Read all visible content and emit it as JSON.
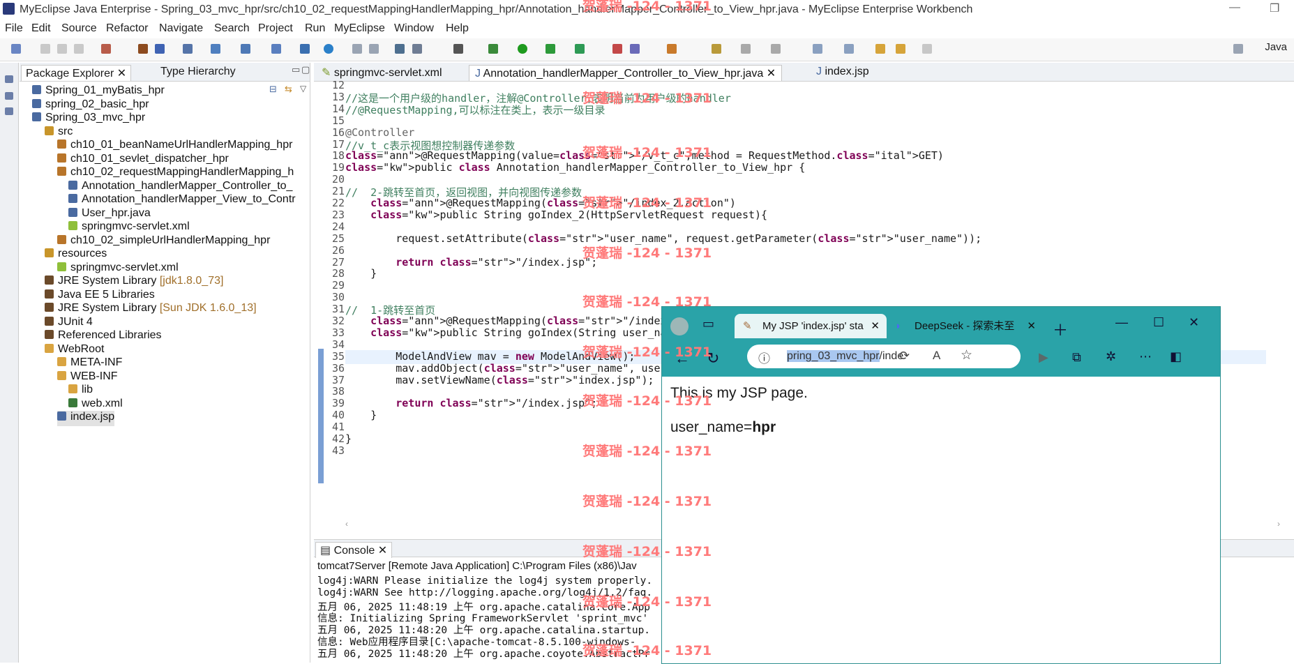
{
  "window": {
    "title": "MyEclipse Java Enterprise - Spring_03_mvc_hpr/src/ch10_02_requestMappingHandlerMapping_hpr/Annotation_handlerMapper_Controller_to_View_hpr.java - MyEclipse Enterprise Workbench",
    "min": "—",
    "restore": "❐"
  },
  "menu": [
    "File",
    "Edit",
    "Source",
    "Refactor",
    "Navigate",
    "Search",
    "Project",
    "Run",
    "MyEclipse",
    "Window",
    "Help"
  ],
  "perspective": "Java",
  "left_pane": {
    "tabs": [
      "Package Explorer",
      "Type Hierarchy"
    ],
    "tree": [
      {
        "label": "Spring_01_myBatis_hpr",
        "deco": ""
      },
      {
        "label": "spring_02_basic_hpr",
        "deco": ""
      },
      {
        "label": "Spring_03_mvc_hpr",
        "deco": ""
      },
      {
        "label": "src",
        "deco": ""
      },
      {
        "label": "ch10_01_beanNameUrlHandlerMapping_hpr",
        "deco": ""
      },
      {
        "label": "ch10_01_sevlet_dispatcher_hpr",
        "deco": ""
      },
      {
        "label": "ch10_02_requestMappingHandlerMapping_h",
        "deco": ""
      },
      {
        "label": "Annotation_handlerMapper_Controller_to_",
        "deco": ""
      },
      {
        "label": "Annotation_handlerMapper_View_to_Contr",
        "deco": ""
      },
      {
        "label": "User_hpr.java",
        "deco": ""
      },
      {
        "label": "springmvc-servlet.xml",
        "deco": ""
      },
      {
        "label": "ch10_02_simpleUrlHandlerMapping_hpr",
        "deco": ""
      },
      {
        "label": "resources",
        "deco": ""
      },
      {
        "label": "springmvc-servlet.xml",
        "deco": ""
      },
      {
        "label": "JRE System Library ",
        "deco": "[jdk1.8.0_73]"
      },
      {
        "label": "Java EE 5 Libraries",
        "deco": ""
      },
      {
        "label": "JRE System Library ",
        "deco": "[Sun JDK 1.6.0_13]"
      },
      {
        "label": "JUnit 4",
        "deco": ""
      },
      {
        "label": "Referenced Libraries",
        "deco": ""
      },
      {
        "label": "WebRoot",
        "deco": ""
      },
      {
        "label": "META-INF",
        "deco": ""
      },
      {
        "label": "WEB-INF",
        "deco": ""
      },
      {
        "label": "lib",
        "deco": ""
      },
      {
        "label": "web.xml",
        "deco": ""
      },
      {
        "label": "index.jsp",
        "deco": ""
      }
    ]
  },
  "editor": {
    "tabs": [
      "springmvc-servlet.xml",
      "Annotation_handlerMapper_Controller_to_View_hpr.java",
      "index.jsp"
    ],
    "lines": [
      {
        "n": "12",
        "html": ""
      },
      {
        "n": "13",
        "text": "//这是一个用户级的handler，注解@Controller,表明当前为用户级的handler",
        "cls": "cmt"
      },
      {
        "n": "14",
        "text": "//@RequestMapping,可以标注在类上，表示一级目录",
        "cls": "cmt"
      },
      {
        "n": "15",
        "text": ""
      },
      {
        "n": "16",
        "text": "@Controller",
        "cls": "ann"
      },
      {
        "n": "17",
        "text": "//v_t_c表示视图想控制器传递参数",
        "cls": "cmt"
      },
      {
        "n": "18",
        "text": "@RequestMapping(value=\"/v_t_c\",method = RequestMethod.GET)",
        "cls": "mix"
      },
      {
        "n": "19",
        "text": "public class Annotation_handlerMapper_Controller_to_View_hpr {",
        "cls": "mix"
      },
      {
        "n": "20",
        "text": ""
      },
      {
        "n": "21",
        "text": "//  2-跳转至首页，返回视图，并向视图传递参数",
        "cls": "cmt"
      },
      {
        "n": "22",
        "text": "    @RequestMapping(\"/index_2.action\")",
        "cls": "mix"
      },
      {
        "n": "23",
        "text": "    public String goIndex_2(HttpServletRequest request){",
        "cls": "mix"
      },
      {
        "n": "24",
        "text": ""
      },
      {
        "n": "25",
        "text": "        request.setAttribute(\"user_name\", request.getParameter(\"user_name\"));",
        "cls": "mix"
      },
      {
        "n": "26",
        "text": ""
      },
      {
        "n": "27",
        "text": "        return \"/index.jsp\";",
        "cls": "mix"
      },
      {
        "n": "28",
        "text": "    }"
      },
      {
        "n": "29",
        "text": ""
      },
      {
        "n": "30",
        "text": ""
      },
      {
        "n": "31",
        "text": "//  1-跳转至首页",
        "cls": "cmt"
      },
      {
        "n": "32",
        "text": "    @RequestMapping(\"/index.action\")",
        "cls": "mix"
      },
      {
        "n": "33",
        "text": "    public String goIndex(String user_name){",
        "cls": "mix"
      },
      {
        "n": "34",
        "text": ""
      },
      {
        "n": "35",
        "text": "        ModelAndView mav = new ModelAndView();",
        "cls": "mix"
      },
      {
        "n": "36",
        "text": "        mav.addObject(\"user_name\", user_name);",
        "cls": "mix"
      },
      {
        "n": "37",
        "text": "        mav.setViewName(\"index.jsp\");",
        "cls": "mix"
      },
      {
        "n": "38",
        "text": ""
      },
      {
        "n": "39",
        "text": "        return \"/index.jsp\";",
        "cls": "mix"
      },
      {
        "n": "40",
        "text": "    }"
      },
      {
        "n": "41",
        "text": ""
      },
      {
        "n": "42",
        "text": "}"
      },
      {
        "n": "43",
        "text": ""
      }
    ]
  },
  "console": {
    "tab": "Console",
    "header": "tomcat7Server [Remote Java Application] C:\\Program Files (x86)\\Jav",
    "lines": [
      "log4j:WARN Please initialize the log4j system properly.",
      "log4j:WARN See http://logging.apache.org/log4j/1.2/faq.",
      "五月 06, 2025 11:48:19 上午 org.apache.catalina.core.App",
      "信息: Initializing Spring FrameworkServlet 'sprint_mvc'",
      "五月 06, 2025 11:48:20 上午 org.apache.catalina.startup.",
      "信息: Web应用程序目录[C:\\apache-tomcat-8.5.100-windows-",
      "五月 06, 2025 11:48:20 上午 org.apache.coyote.AbstractPr"
    ]
  },
  "browser": {
    "tab_active": "My JSP 'index.jsp' sta",
    "tab_other": "DeepSeek - 探索未至",
    "url_highlight": "pring_03_mvc_hpr",
    "url_rest": "/inde",
    "page_line1": "This is my JSP page.",
    "page_label": "user_name=",
    "page_value": "hpr"
  },
  "watermark": "贺蓬瑞 -124 - 1371"
}
